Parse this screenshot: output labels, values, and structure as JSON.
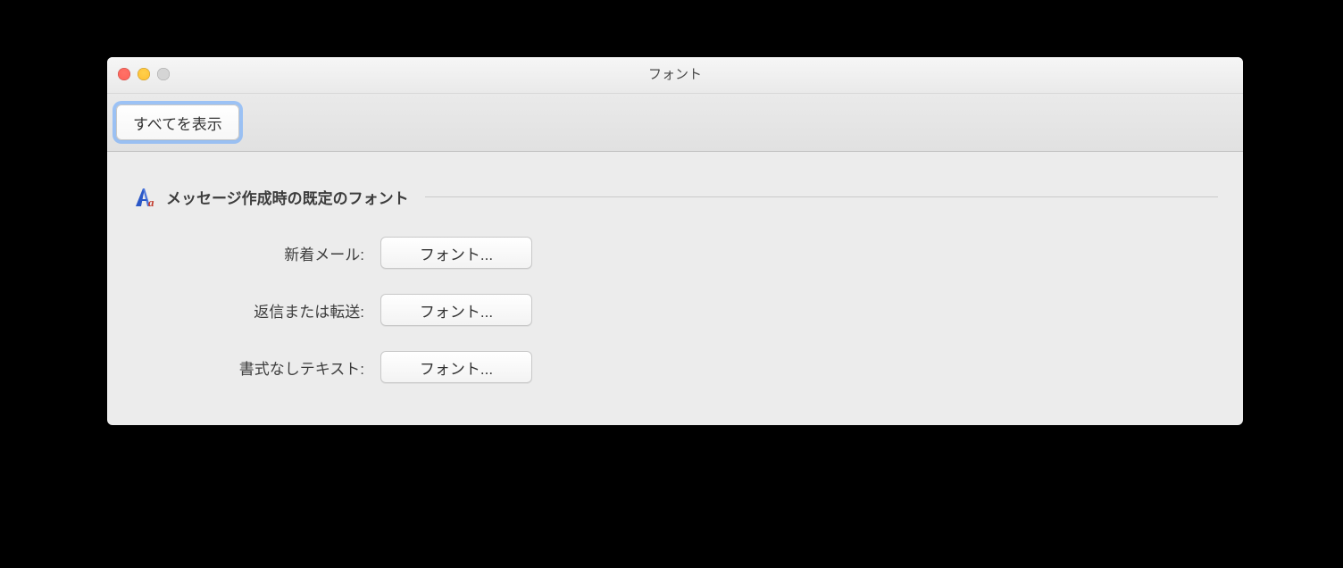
{
  "window": {
    "title": "フォント"
  },
  "toolbar": {
    "show_all_label": "すべてを表示"
  },
  "section": {
    "title": "メッセージ作成時の既定のフォント",
    "icon": "font-icon"
  },
  "rows": [
    {
      "label": "新着メール:",
      "button": "フォント..."
    },
    {
      "label": "返信または転送:",
      "button": "フォント..."
    },
    {
      "label": "書式なしテキスト:",
      "button": "フォント..."
    }
  ]
}
